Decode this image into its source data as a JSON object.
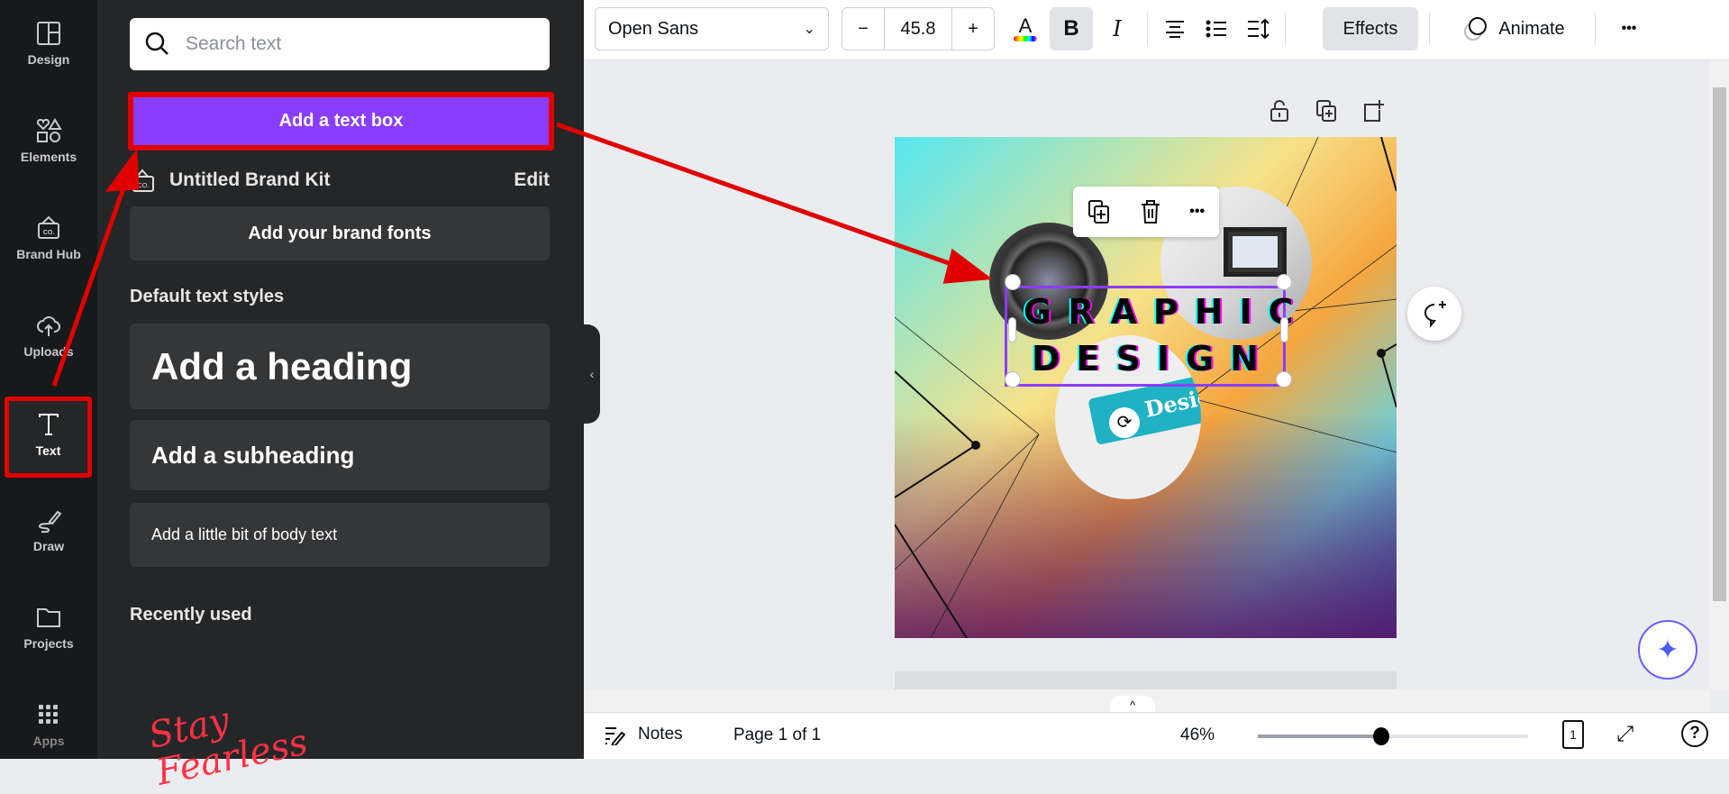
{
  "rail": [
    {
      "label": "Design",
      "icon": "layout-icon"
    },
    {
      "label": "Elements",
      "icon": "shapes-icon"
    },
    {
      "label": "Brand Hub",
      "icon": "brand-icon"
    },
    {
      "label": "Uploads",
      "icon": "upload-cloud-icon"
    },
    {
      "label": "Text",
      "icon": "text-icon"
    },
    {
      "label": "Draw",
      "icon": "draw-icon"
    },
    {
      "label": "Projects",
      "icon": "folder-icon"
    },
    {
      "label": "Apps",
      "icon": "apps-grid-icon"
    }
  ],
  "panel": {
    "search_placeholder": "Search text",
    "add_text_box": "Add a text box",
    "brand_kit": "Untitled Brand Kit",
    "edit": "Edit",
    "brand_fonts": "Add your brand fonts",
    "default_styles": "Default text styles",
    "heading": "Add a heading",
    "subheading": "Add a subheading",
    "body": "Add a little bit of body text",
    "recently_used": "Recently used",
    "recent_preview": "Stay Fearless"
  },
  "toolbar": {
    "font": "Open Sans",
    "font_size": "45.8",
    "minus": "−",
    "plus": "+",
    "bold": "B",
    "italic": "I",
    "effects": "Effects",
    "animate": "Animate",
    "more": "•••"
  },
  "canvas": {
    "line1": "GRAPHIC",
    "line2": "DESIGN",
    "image_text": "Design"
  },
  "bottom": {
    "notes": "Notes",
    "page": "Page 1 of 1",
    "zoom": "46%",
    "zoom_value": 46,
    "page_count": "1",
    "help": "?"
  },
  "colors": {
    "accent": "#8b3dff",
    "annotation": "#e00000"
  }
}
